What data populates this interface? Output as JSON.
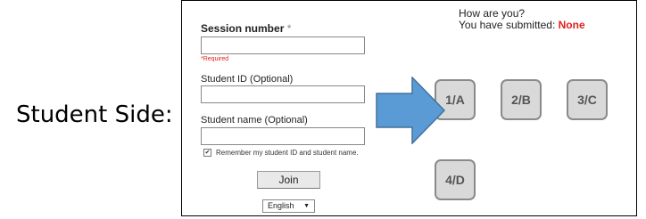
{
  "side_label": "Student Side:",
  "form": {
    "session_label": "Session number",
    "session_required_star": "*",
    "session_value": "",
    "required_text": "*Required",
    "student_id_label": "Student ID (Optional)",
    "student_id_value": "",
    "student_name_label": "Student name (Optional)",
    "student_name_value": "",
    "remember_checked": true,
    "remember_label": "Remember my student ID and student name.",
    "join_label": "Join",
    "language_selected": "English"
  },
  "status": {
    "greeting": "How are you?",
    "submitted_prefix": "You have submitted: ",
    "submitted_value": "None"
  },
  "answers": [
    {
      "label": "1/A"
    },
    {
      "label": "2/B"
    },
    {
      "label": "3/C"
    },
    {
      "label": "4/D"
    }
  ],
  "colors": {
    "arrow_fill": "#5b9bd5",
    "arrow_stroke": "#41719c",
    "required_red": "#e0201c",
    "answer_bg": "#d9d9d9",
    "answer_border": "#8a8a8a"
  }
}
